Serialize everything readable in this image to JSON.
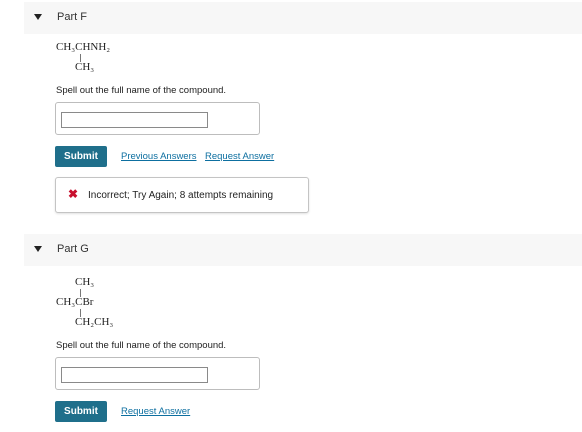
{
  "partF": {
    "title": "Part F",
    "structure": {
      "line1": "CH₃CHNH₂",
      "line2": "CH₃"
    },
    "prompt": "Spell out the full name of the compound.",
    "answer_value": "",
    "submit_label": "Submit",
    "previous_answers_label": "Previous Answers",
    "request_answer_label": "Request Answer",
    "feedback": {
      "icon": "error-x-icon",
      "message": "Incorrect; Try Again; 8 attempts remaining"
    }
  },
  "partG": {
    "title": "Part G",
    "structure": {
      "line1": "CH₃",
      "line2": "CH₃CBr",
      "line3": "CH₂CH₃"
    },
    "prompt": "Spell out the full name of the compound.",
    "answer_value": "",
    "submit_label": "Submit",
    "request_answer_label": "Request Answer"
  },
  "colors": {
    "accent": "#1f6f8b",
    "link": "#0d6fa0",
    "error": "#c8102e",
    "header_bg": "#f7f7f7"
  }
}
